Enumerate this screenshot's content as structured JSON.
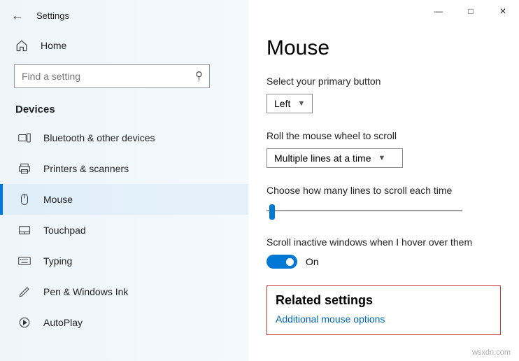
{
  "titlebar": {
    "title": "Settings"
  },
  "home": {
    "label": "Home"
  },
  "search": {
    "placeholder": "Find a setting"
  },
  "section_header": "Devices",
  "nav": [
    {
      "label": "Bluetooth & other devices"
    },
    {
      "label": "Printers & scanners"
    },
    {
      "label": "Mouse"
    },
    {
      "label": "Touchpad"
    },
    {
      "label": "Typing"
    },
    {
      "label": "Pen & Windows Ink"
    },
    {
      "label": "AutoPlay"
    }
  ],
  "page": {
    "title": "Mouse",
    "primary_button": {
      "label": "Select your primary button",
      "value": "Left"
    },
    "scroll_wheel": {
      "label": "Roll the mouse wheel to scroll",
      "value": "Multiple lines at a time"
    },
    "lines": {
      "label": "Choose how many lines to scroll each time"
    },
    "inactive": {
      "label": "Scroll inactive windows when I hover over them",
      "state": "On"
    },
    "related": {
      "title": "Related settings",
      "link": "Additional mouse options"
    }
  },
  "watermark": "wsxdn.com"
}
